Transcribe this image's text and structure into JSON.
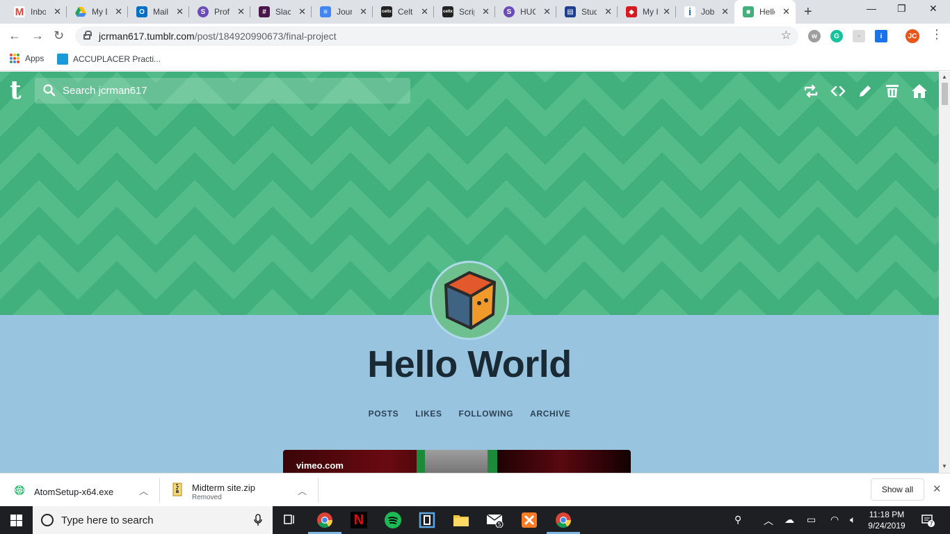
{
  "browser": {
    "tabs": [
      {
        "title": "Inbo",
        "favicon": "gmail-icon",
        "color": "#ea4335"
      },
      {
        "title": "My D",
        "favicon": "drive-icon",
        "color": "#fbbc04"
      },
      {
        "title": "Mail",
        "favicon": "outlook-icon",
        "color": "#0072c6"
      },
      {
        "title": "Prof",
        "favicon": "s-icon",
        "color": "#6b4bb8"
      },
      {
        "title": "Slacl",
        "favicon": "slack-icon",
        "color": "#4a154b"
      },
      {
        "title": "Jour",
        "favicon": "docs-icon",
        "color": "#4285f4"
      },
      {
        "title": "Celt",
        "favicon": "celtx-icon",
        "color": "#222222"
      },
      {
        "title": "Scrip",
        "favicon": "celtx-icon",
        "color": "#222222"
      },
      {
        "title": "HUC",
        "favicon": "s-icon",
        "color": "#6b4bb8"
      },
      {
        "title": "Stud",
        "favicon": "doc-icon",
        "color": "#1d3f8e"
      },
      {
        "title": "My I",
        "favicon": "red-app-icon",
        "color": "#d71920"
      },
      {
        "title": "Job",
        "favicon": "info-icon",
        "color": "#2a6ebb"
      },
      {
        "title": "Hello",
        "favicon": "cube-icon",
        "color": "#41b07c",
        "active": true
      }
    ],
    "url_host": "jcrman617.tumblr.com",
    "url_path": "/post/184920990673/final-project",
    "profile_initials": "JC",
    "bookmarks": [
      {
        "label": "Apps"
      },
      {
        "label": "ACCUPLACER Practi..."
      }
    ]
  },
  "tumblr": {
    "logo": "t",
    "search_placeholder": "Search jcrman617",
    "blog_title": "Hello World",
    "nav": [
      "POSTS",
      "LIKES",
      "FOLLOWING",
      "ARCHIVE"
    ],
    "video_source": "vimeo.com",
    "colors": {
      "header": "#41b07c",
      "body": "#98c4e0",
      "title": "#1a2a34"
    }
  },
  "downloads": {
    "items": [
      {
        "name": "AtomSetup-x64.exe",
        "status": ""
      },
      {
        "name": "Midterm site.zip",
        "status": "Removed"
      }
    ],
    "show_all": "Show all"
  },
  "taskbar": {
    "search_placeholder": "Type here to search",
    "time": "11:18 PM",
    "date": "9/24/2019",
    "notification_count": "7",
    "mail_count": "5"
  }
}
